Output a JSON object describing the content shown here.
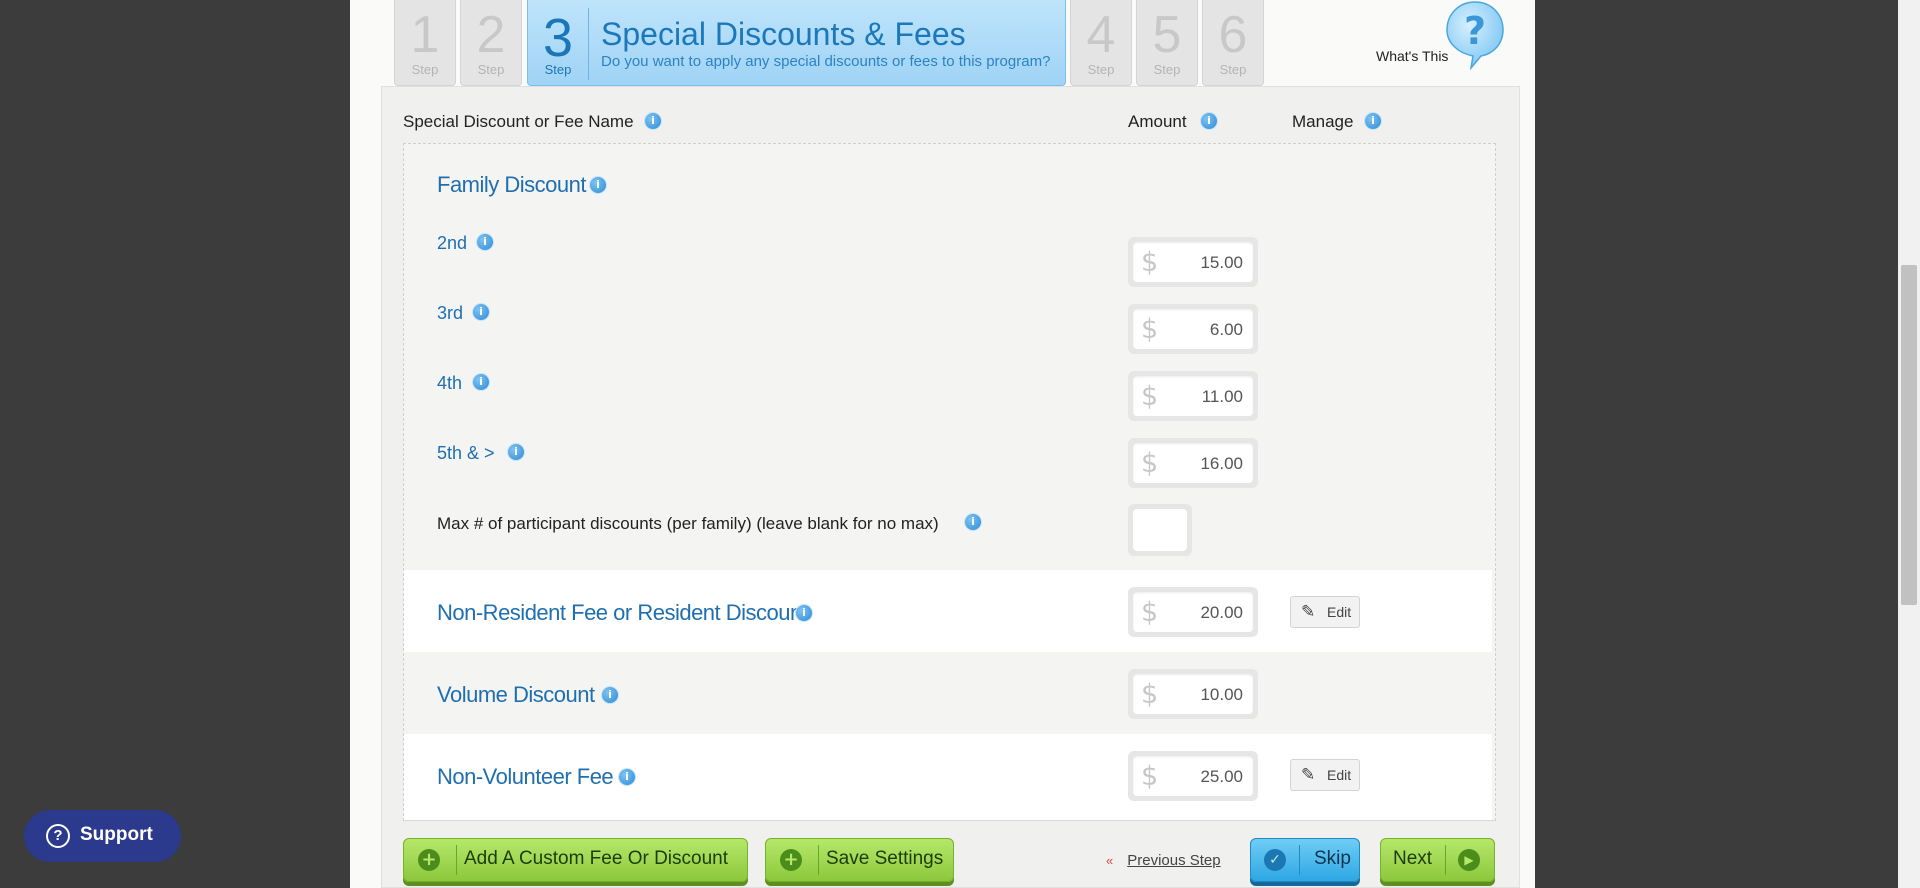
{
  "steps": [
    {
      "num": "1",
      "label": "Step"
    },
    {
      "num": "2",
      "label": "Step"
    },
    {
      "num": "3",
      "label": "Step"
    },
    {
      "num": "4",
      "label": "Step"
    },
    {
      "num": "5",
      "label": "Step"
    },
    {
      "num": "6",
      "label": "Step"
    }
  ],
  "active_step": {
    "title": "Special Discounts & Fees",
    "subtitle": "Do you want to apply any special discounts or fees to this program?"
  },
  "help": {
    "label": "What's This",
    "icon": "question-bubble-icon"
  },
  "columns": {
    "name": "Special Discount or Fee Name",
    "amount": "Amount",
    "manage": "Manage"
  },
  "info_icon": "i",
  "currency": "$",
  "family_discount": {
    "title": "Family Discount",
    "tiers": [
      {
        "label": "2nd",
        "amount": "15.00"
      },
      {
        "label": "3rd",
        "amount": "6.00"
      },
      {
        "label": "4th",
        "amount": "11.00"
      },
      {
        "label": "5th & >",
        "amount": "16.00"
      }
    ],
    "max_label": "Max # of participant discounts (per family) (leave blank for no max)",
    "max_value": ""
  },
  "fees": [
    {
      "title": "Non-Resident Fee or Resident Discount",
      "amount": "20.00",
      "manage": "Edit"
    },
    {
      "title": "Volume Discount",
      "amount": "10.00",
      "manage": ""
    },
    {
      "title": "Non-Volunteer Fee",
      "amount": "25.00",
      "manage": "Edit"
    }
  ],
  "actions": {
    "add_custom": "Add A Custom Fee Or Discount",
    "save": "Save Settings",
    "previous": "Previous Step",
    "skip": "Skip",
    "next": "Next"
  },
  "support": {
    "label": "Support",
    "icon": "question-circle-icon"
  },
  "colors": {
    "accent_blue": "#1f6fb0",
    "step_active": "#9fd3f5",
    "button_green": "#8cc83c",
    "button_blue": "#2ea7e3",
    "support_bg": "#2b3a8c"
  }
}
